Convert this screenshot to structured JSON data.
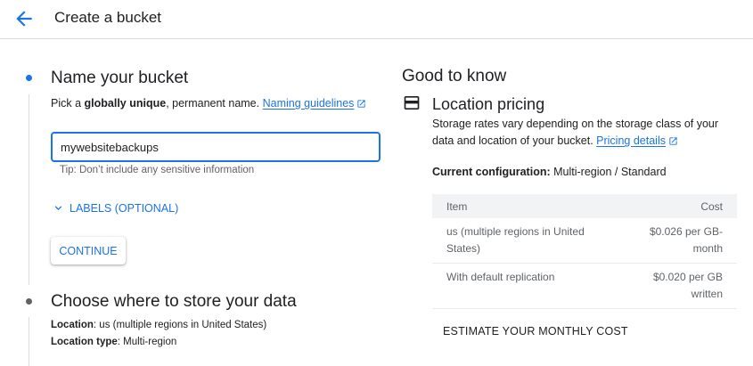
{
  "header": {
    "title": "Create a bucket",
    "back_icon": "arrow-back-icon"
  },
  "step1": {
    "title": "Name your bucket",
    "desc_prefix": "Pick a ",
    "desc_bold": "globally unique",
    "desc_suffix": ", permanent name. ",
    "link": "Naming guidelines",
    "input_value": "mywebsitebackups",
    "tip": "Tip: Don’t include any sensitive information",
    "labels_toggle": "LABELS (OPTIONAL)",
    "continue": "CONTINUE"
  },
  "step2": {
    "title": "Choose where to store your data",
    "location_label": "Location",
    "location_value": ": us (multiple regions in United States)",
    "type_label": "Location type",
    "type_value": ": Multi-region"
  },
  "info": {
    "heading": "Good to know",
    "pricing_title": "Location pricing",
    "pricing_desc_line1": "Storage rates vary depending on the storage class of your",
    "pricing_desc_line2": "data and location of your bucket. ",
    "pricing_link": "Pricing details",
    "config_label": "Current configuration:",
    "config_value": " Multi-region / Standard",
    "table": {
      "headers": [
        "Item",
        "Cost"
      ],
      "rows": [
        {
          "item_l1": "us (multiple regions in United",
          "item_l2": "States)",
          "cost_l1": "$0.026 per GB-",
          "cost_l2": "month"
        },
        {
          "item_l1": "With default replication",
          "item_l2": "",
          "cost_l1": "$0.020 per GB",
          "cost_l2": "written"
        }
      ]
    },
    "estimate": "ESTIMATE YOUR MONTHLY COST"
  },
  "colors": {
    "accent": "#1a73e8",
    "text": "#202124",
    "muted": "#5f6368"
  }
}
